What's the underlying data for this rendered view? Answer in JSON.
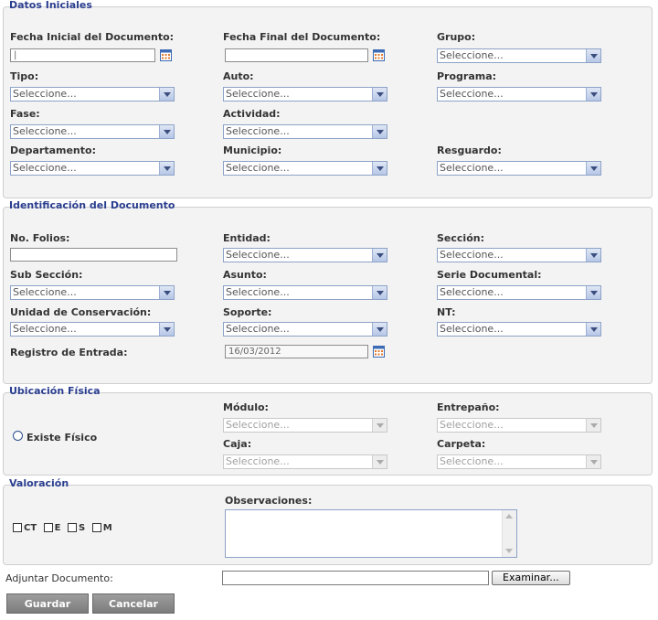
{
  "sections": {
    "datos": "Datos Iniciales",
    "identificacion": "Identificación del Documento",
    "ubicacion": "Ubicación Física",
    "valoracion": "Valoración"
  },
  "placeholder": "Seleccione...",
  "datos": {
    "fecha_inicial": "Fecha Inicial del Documento:",
    "fecha_final": "Fecha Final del Documento:",
    "grupo": "Grupo:",
    "tipo": "Tipo:",
    "auto": "Auto:",
    "programa": "Programa:",
    "fase": "Fase:",
    "actividad": "Actividad:",
    "departamento": "Departamento:",
    "municipio": "Municipio:",
    "resguardo": "Resguardo:",
    "fecha_inicial_value": "|",
    "fecha_final_value": ""
  },
  "identificacion": {
    "folios": "No. Folios:",
    "entidad": "Entidad:",
    "seccion": "Sección:",
    "subseccion": "Sub Sección:",
    "asunto": "Asunto:",
    "serie": "Serie Documental:",
    "unidad": "Unidad de Conservación:",
    "soporte": "Soporte:",
    "nt": "NT:",
    "registro": "Registro de Entrada:",
    "registro_value": "16/03/2012"
  },
  "ubicacion": {
    "existe": "Existe Físico",
    "modulo": "Módulo:",
    "entrepano": "Entrepaño:",
    "caja": "Caja:",
    "carpeta": "Carpeta:"
  },
  "valoracion": {
    "ct": "CT",
    "e": "E",
    "s": "S",
    "m": "M",
    "observaciones": "Observaciones:"
  },
  "adjuntar": "Adjuntar Documento:",
  "examinar": "Examinar...",
  "buttons": {
    "guardar": "Guardar",
    "cancelar": "Cancelar"
  }
}
